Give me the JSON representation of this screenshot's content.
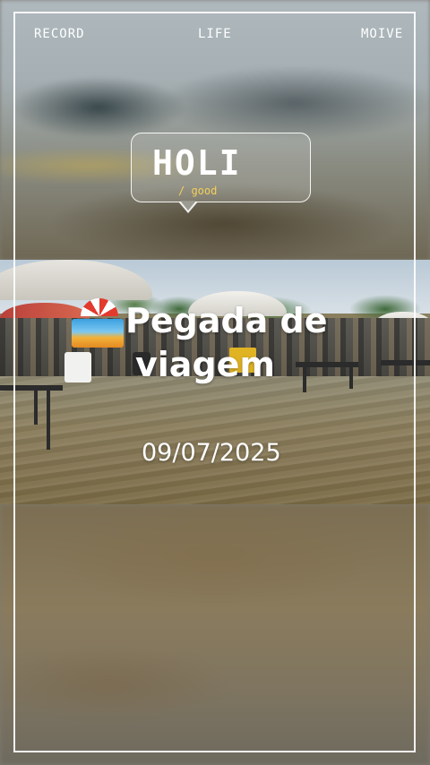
{
  "header": {
    "left_label": "RECORD",
    "center_label": "LIFE",
    "right_label": "MOIVE"
  },
  "sticker": {
    "title": "HOLI",
    "subtitle": "/ good"
  },
  "caption": {
    "line1": "Pegada de",
    "line2": "viagem",
    "emoji_icon": "beach-umbrella-emoji-icon"
  },
  "date": "09/07/2025",
  "colors": {
    "frame": "#ffffff",
    "sticker_subtitle": "#f2d15a",
    "text": "#ffffff"
  }
}
